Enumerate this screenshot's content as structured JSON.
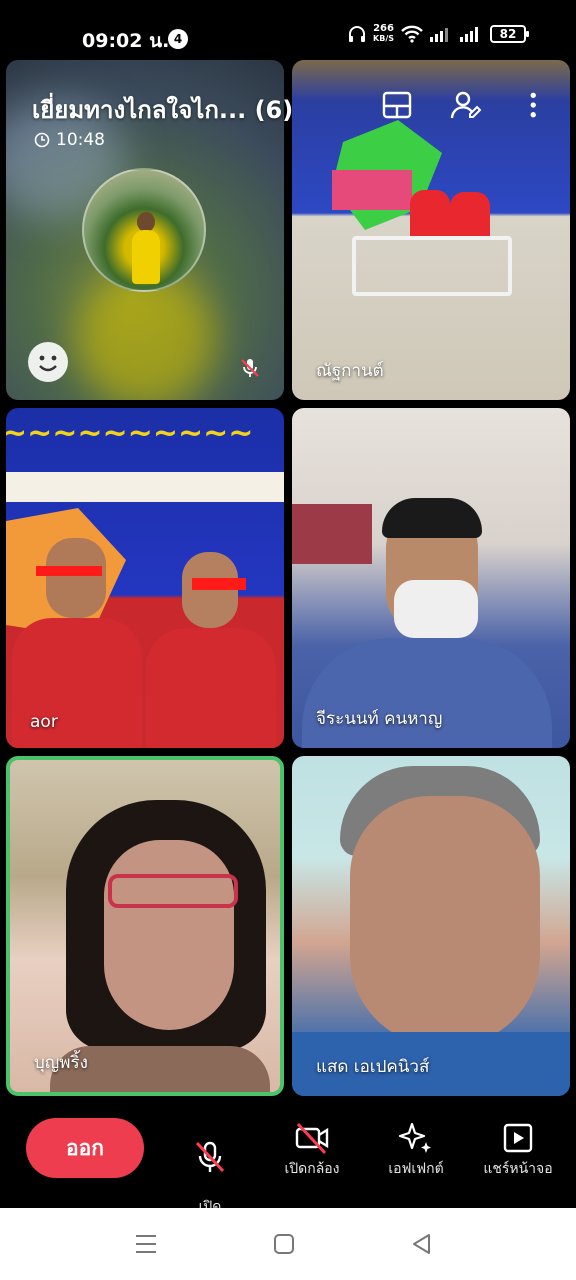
{
  "status_bar": {
    "time": "09:02 น.",
    "notification_count": "4",
    "net_speed": "266",
    "net_unit": "KB/S",
    "battery": "82"
  },
  "meeting": {
    "title": "เยี่ยมทางไกลใจไก... (6)",
    "elapsed": "10:48"
  },
  "participants": [
    {
      "name": ""
    },
    {
      "name": "ณัฐกานต์"
    },
    {
      "name": "aor"
    },
    {
      "name": "จีระนนท์ คนหาญ"
    },
    {
      "name": "บุญพริ้ง"
    },
    {
      "name": "แสด เอเปคนิวส์"
    }
  ],
  "icons": {
    "layout": "layout-grid-icon",
    "participants": "add-participant-icon",
    "more": "more-vertical-icon",
    "emoji": "smile-icon",
    "muted": "mic-off-icon"
  },
  "controls": {
    "leave": "ออก",
    "mic": "เปิด\nไมโครโฟน",
    "camera": "เปิดกล้อง",
    "effects": "เอฟเฟกต์",
    "share": "แชร์หน้าจอ"
  },
  "colors": {
    "leave_button": "#ee3d4e",
    "active_speaker_border": "#4cc36a"
  }
}
